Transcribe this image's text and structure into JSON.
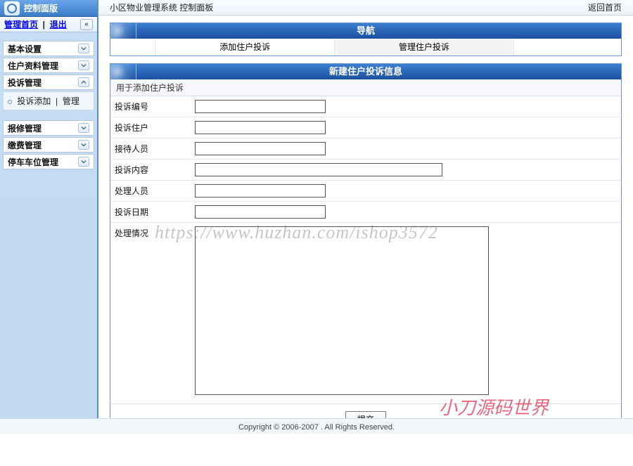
{
  "sidebar": {
    "title": "控制面版",
    "ctrl_home": "管理首页",
    "ctrl_exit": "退出",
    "groups": {
      "basic": "基本设置",
      "resident": "住户资料管理",
      "complaint": "投诉管理",
      "repair": "报修管理",
      "fee": "缴费管理",
      "parking": "停车车位管理"
    },
    "complaint_sub_add": "投诉添加",
    "complaint_sub_manage": "管理"
  },
  "topbar": {
    "title": "小区物业管理系统 控制面板",
    "back": "返回首页"
  },
  "nav": {
    "title": "导航",
    "tab_add": "添加住户投诉",
    "tab_manage": "管理住户投诉"
  },
  "form": {
    "title": "新建住户投诉信息",
    "desc": "用于添加住户投诉",
    "fields": {
      "no": "投诉编号",
      "resident": "投诉住户",
      "receiver": "接待人员",
      "content": "投诉内容",
      "handler": "处理人员",
      "date": "投诉日期",
      "result": "处理情况"
    },
    "submit": "提交"
  },
  "footer": "Copyright © 2006-2007 . All Rights Reserved.",
  "watermark1": "https://www.huzhan.com/ishop3572",
  "watermark2": "小刀源码世界"
}
